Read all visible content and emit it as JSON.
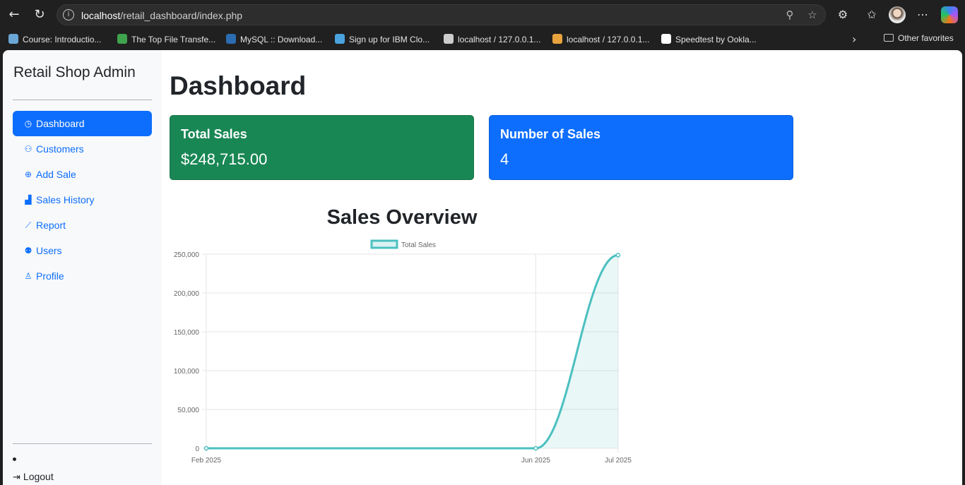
{
  "browser": {
    "url_host": "localhost",
    "url_path": "/retail_dashboard/index.php",
    "bookmarks": [
      {
        "label": "Course: Introductio...",
        "color": "#6aa6d6"
      },
      {
        "label": "The Top File Transfe...",
        "color": "#3fa34d"
      },
      {
        "label": "MySQL :: Download...",
        "color": "#2b6cb0"
      },
      {
        "label": "Sign up for IBM Clo...",
        "color": "#4aa3df"
      },
      {
        "label": "localhost / 127.0.0.1...",
        "color": "#cccccc"
      },
      {
        "label": "localhost / 127.0.0.1...",
        "color": "#e8a33d"
      },
      {
        "label": "Speedtest by Ookla...",
        "color": "#ffffff"
      }
    ],
    "other_favorites": "Other favorites"
  },
  "sidebar": {
    "brand": "Retail Shop Admin",
    "items": [
      {
        "label": "Dashboard",
        "icon": "speedometer-icon",
        "glyph": "◷",
        "active": true
      },
      {
        "label": "Customers",
        "icon": "people-icon",
        "glyph": "⚇",
        "active": false
      },
      {
        "label": "Add Sale",
        "icon": "plus-circle-icon",
        "glyph": "⊕",
        "active": false
      },
      {
        "label": "Sales History",
        "icon": "bar-chart-icon",
        "glyph": "▟",
        "active": false
      },
      {
        "label": "Report",
        "icon": "graph-up-icon",
        "glyph": "⟋",
        "active": false
      },
      {
        "label": "Users",
        "icon": "people-fill-icon",
        "glyph": "⚉",
        "active": false
      },
      {
        "label": "Profile",
        "icon": "person-icon",
        "glyph": "♙",
        "active": false
      }
    ],
    "logout": "Logout"
  },
  "main": {
    "title": "Dashboard",
    "cards": [
      {
        "title": "Total Sales",
        "value": "$248,715.00",
        "color": "#198754"
      },
      {
        "title": "Number of Sales",
        "value": "4",
        "color": "#0d6efd"
      }
    ],
    "chart_title": "Sales Overview"
  },
  "chart_data": {
    "type": "area",
    "title": "Sales Overview",
    "x": [
      "Feb 2025",
      "Jun 2025",
      "Jul 2025"
    ],
    "series": [
      {
        "name": "Total Sales",
        "values": [
          0,
          0,
          248715
        ],
        "color": "#4bc0c0"
      }
    ],
    "yticks": [
      "0",
      "50,000",
      "100,000",
      "150,000",
      "200,000",
      "250,000"
    ],
    "ylim": [
      0,
      250000
    ],
    "grid": true,
    "legend": "top"
  }
}
